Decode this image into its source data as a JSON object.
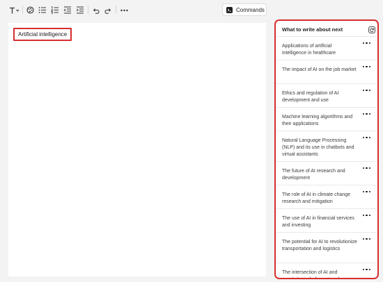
{
  "toolbar": {
    "text_style_icon": "text-format-icon",
    "commands_label": "Commands"
  },
  "editor": {
    "title": "Artificial intelligence"
  },
  "sidebar": {
    "heading": "What to write about next",
    "suggestions": [
      {
        "text": "Applications of artificial intelligence in healthcare"
      },
      {
        "text": "The impact of AI on the job market"
      },
      {
        "text": "Ethics and regulation of AI development and use"
      },
      {
        "text": "Machine learning algorithms and their applications"
      },
      {
        "text": "Natural Language Processing (NLP) and its use in chatbots and virtual assistants"
      },
      {
        "text": "The future of AI research and development"
      },
      {
        "text": "The role of AI in climate change research and mitigation"
      },
      {
        "text": "The use of AI in financial services and investing"
      },
      {
        "text": "The potential for AI to revolutionize transportation and logistics"
      },
      {
        "text": "The intersection of AI and creativity, including art and"
      }
    ]
  },
  "colors": {
    "highlight_border": "#d72d2d",
    "page_background": "#f3f3f3"
  }
}
